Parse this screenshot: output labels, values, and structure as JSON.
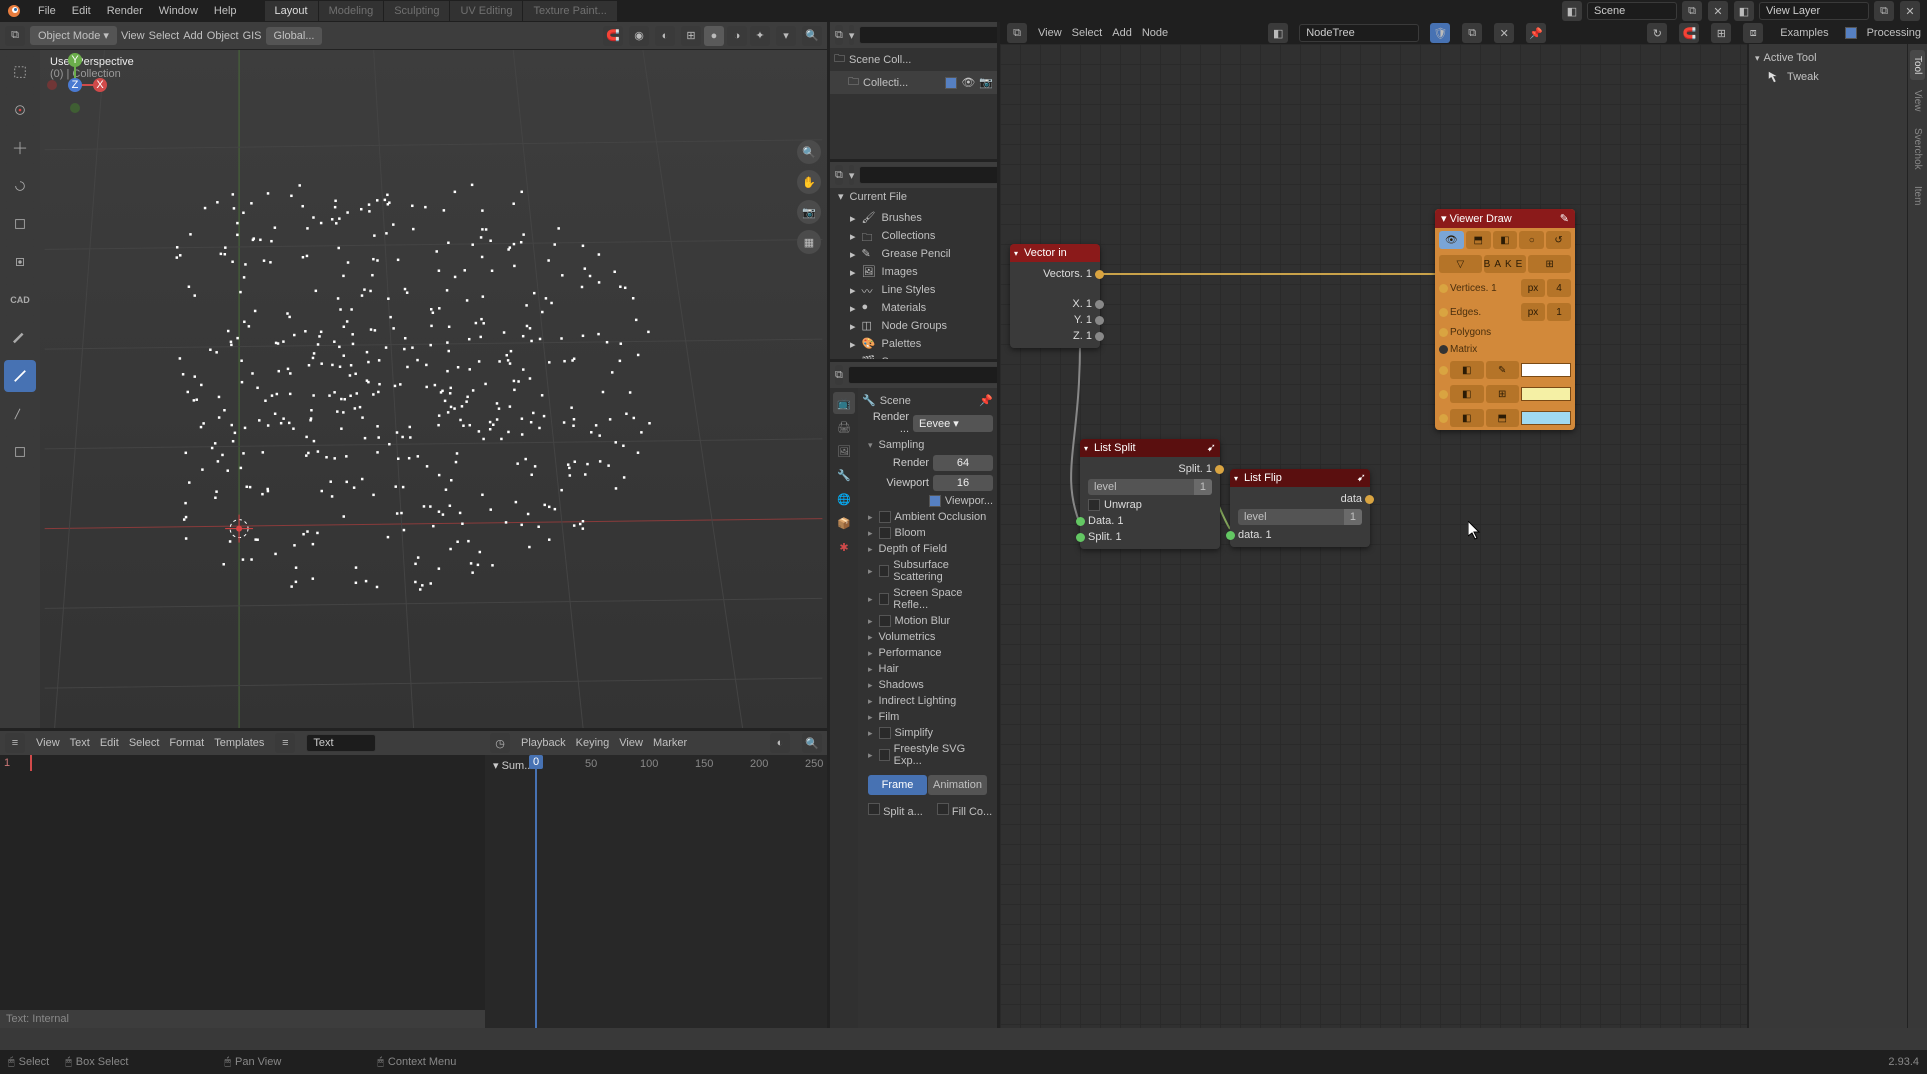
{
  "menu": [
    "File",
    "Edit",
    "Render",
    "Window",
    "Help"
  ],
  "workspaces": [
    "Layout",
    "Modeling",
    "Sculpting",
    "UV Editing",
    "Texture Paint..."
  ],
  "scene_name": "Scene",
  "view_layer": "View Layer",
  "viewport": {
    "mode": "Object Mode",
    "mode_menus": [
      "View",
      "Select",
      "Add",
      "Object",
      "GIS"
    ],
    "orient": "Global...",
    "persp": "User Perspective",
    "coll": "(0) | Collection"
  },
  "text_editor": {
    "menus": [
      "View",
      "Text",
      "Edit",
      "Select",
      "Format",
      "Templates"
    ],
    "datablock": "Text",
    "footer": "Text: Internal"
  },
  "timeline": {
    "menus": [
      "Playback",
      "Keying",
      "View",
      "Marker"
    ],
    "ticks": [
      "0",
      "50",
      "100",
      "150",
      "200",
      "250"
    ],
    "summary": "Sum...",
    "current": "0"
  },
  "outliner": {
    "root": "Scene Coll...",
    "child": "Collecti..."
  },
  "filebrowser": {
    "header": "Current File",
    "items": [
      "Brushes",
      "Collections",
      "Grease Pencil",
      "Images",
      "Line Styles",
      "Materials",
      "Node Groups",
      "Palettes",
      "Scenes"
    ]
  },
  "properties": {
    "scene": "Scene",
    "engine_lbl": "Render ...",
    "engine": "Eevee",
    "sampling": "Sampling",
    "render_lbl": "Render",
    "render_val": "64",
    "viewport_lbl": "Viewport",
    "viewport_val": "16",
    "viewport_chk": "Viewpor...",
    "panels": [
      "Ambient Occlusion",
      "Bloom",
      "Depth of Field",
      "Subsurface Scattering",
      "Screen Space Refle...",
      "Motion Blur",
      "Volumetrics",
      "Performance",
      "Hair",
      "Shadows",
      "Indirect Lighting",
      "Film",
      "Simplify",
      "Freestyle SVG Exp..."
    ],
    "panel_has_chk": {
      "Ambient Occlusion": true,
      "Bloom": true,
      "Subsurface Scattering": true,
      "Screen Space Refle...": true,
      "Motion Blur": true,
      "Simplify": true,
      "Freestyle SVG Exp...": true
    },
    "btn_frame": "Frame",
    "btn_anim": "Animation",
    "chk_split": "Split a...",
    "chk_fill": "Fill Co..."
  },
  "node_editor": {
    "menus": [
      "View",
      "Select",
      "Add",
      "Node"
    ],
    "tree": "NodeTree",
    "right_menus": [
      "Examples",
      "Processing"
    ],
    "side_header": "Active Tool",
    "tweak": "Tweak",
    "vtabs": [
      "Tool",
      "View",
      "Sverchok",
      "Item"
    ]
  },
  "nodes": {
    "vector_in": {
      "title": "Vector in",
      "out": "Vectors. 1",
      "inputs": [
        "X. 1",
        "Y. 1",
        "Z. 1"
      ]
    },
    "list_split": {
      "title": "List Split",
      "out": "Split. 1",
      "level_lbl": "level",
      "level_val": "1",
      "unwrap": "Unwrap",
      "in1": "Data. 1",
      "in2": "Split. 1"
    },
    "list_flip": {
      "title": "List Flip",
      "out": "data",
      "level_lbl": "level",
      "level_val": "1",
      "in": "data. 1"
    },
    "viewer": {
      "title": "Viewer Draw",
      "bake": "BAKE",
      "verts_lbl": "Vertices. 1",
      "verts_px": "px",
      "verts_n": "4",
      "edges_lbl": "Edges.",
      "edges_px": "px",
      "edges_n": "1",
      "poly_lbl": "Polygons",
      "matrix_lbl": "Matrix"
    }
  },
  "status": {
    "select": "Select",
    "box": "Box Select",
    "pan": "Pan View",
    "ctx": "Context Menu",
    "ver": "2.93.4"
  }
}
